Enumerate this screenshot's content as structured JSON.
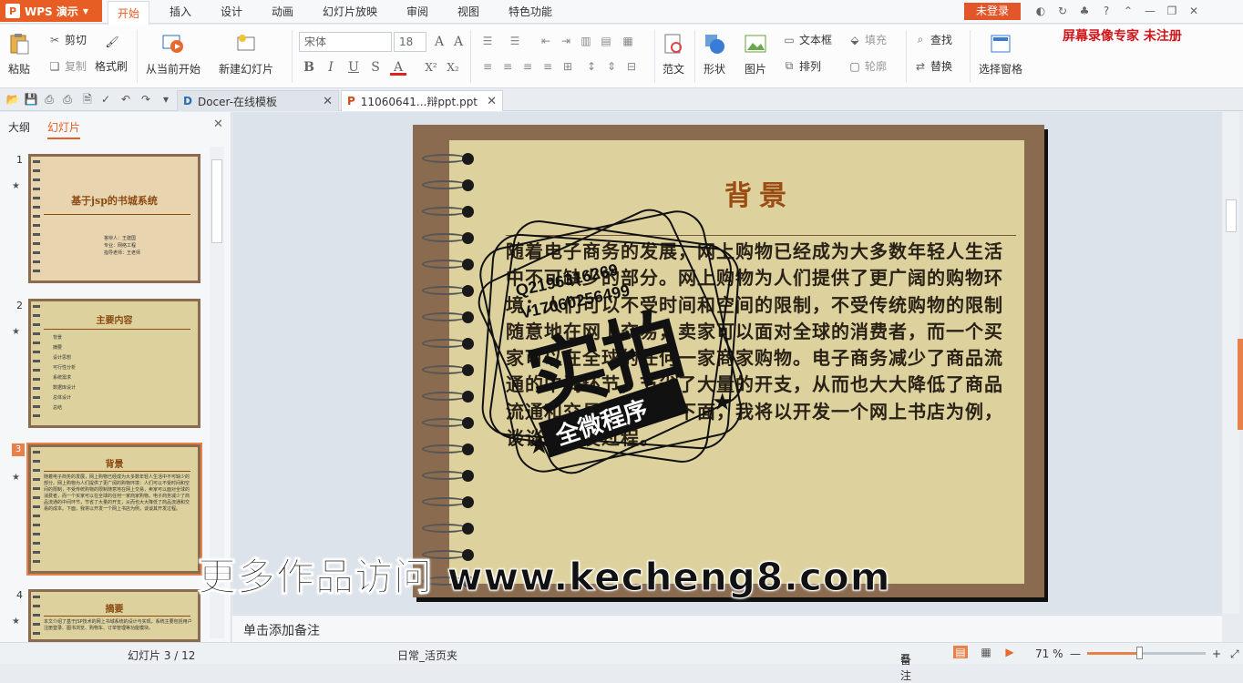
{
  "app": {
    "name": "WPS 演示"
  },
  "menu": [
    "开始",
    "插入",
    "设计",
    "动画",
    "幻灯片放映",
    "审阅",
    "视图",
    "特色功能"
  ],
  "login_label": "未登录",
  "recorder_note": "屏幕录像专家  未注册",
  "ribbon": {
    "paste": "粘贴",
    "cut": "剪切",
    "copy": "复制",
    "format_painter": "格式刷",
    "from_current": "从当前开始",
    "new_slide": "新建幻灯片",
    "font_name": "宋体",
    "font_size": "18",
    "template": "范文",
    "shape": "形状",
    "picture": "图片",
    "textbox": "文本框",
    "arrange": "排列",
    "fill": "填充",
    "outline": "轮廓",
    "find": "查找",
    "replace": "替换",
    "select_pane": "选择窗格"
  },
  "tabs": [
    {
      "label": "Docer-在线模板"
    },
    {
      "label": "11060641...辩ppt.ppt"
    }
  ],
  "panel": {
    "outline_tab": "大纲",
    "slides_tab": "幻灯片"
  },
  "thumbs": [
    {
      "no": "1",
      "title": "基于jsp的书城系统",
      "lines": [
        "答辩人：王建国",
        "专业：网络工程",
        "指导老师：王老师"
      ]
    },
    {
      "no": "2",
      "title": "主要内容",
      "lines": [
        "背景",
        "摘要",
        "设计思想",
        "可行性分析",
        "系统需求",
        "数据库设计",
        "总体设计",
        "总结"
      ]
    },
    {
      "no": "3",
      "title": "背景",
      "text": "随着电子商务的发展，网上购物已经成为大多数年轻人生活中不可缺少的部分。网上购物为人们提供了更广阔的购物环境：人们可以不受时间和空间的限制，不受传统购物的限制随意地在网上交易，卖家可以面对全球的消费者，而一个买家可以在全球的任何一家商家购物。电子商务减少了商品流通的中间环节，节省了大量的开支，从而也大大降低了商品流通和交易的成本。下面，我将以开发一个网上书店为例，谈谈其开发过程。"
    },
    {
      "no": "4",
      "title": "摘要",
      "text": "本文介绍了基于JSP技术的网上书城系统的设计与实现，系统主要包括用户注册登录、图书浏览、购物车、订单管理等功能模块。"
    }
  ],
  "slide": {
    "title": "背景",
    "body": "随着电子商务的发展，网上购物已经成为大多数年轻人生活中不可缺少的部分。网上购物为人们提供了更广阔的购物环境：人们可以不受时间和空间的限制，不受传统购物的限制随意地在网上交易，卖家可以面对全球的消费者，而一个买家可以在全球的任何一家商家购物。电子商务减少了商品流通的中间环节，节省了大量的开支，从而也大大降低了商品流通和交易的成本。下面，我将以开发一个网上书店为例，谈谈其开发过程。"
  },
  "stamp": {
    "line1": "Q2196316269",
    "line2": "V17060256499",
    "big": "实拍",
    "ribbon": "全微程序"
  },
  "watermark": "更多作品访问 www.kecheng8.com",
  "notes_placeholder": "单击添加备注",
  "status": {
    "slide_info": "幻灯片 3 / 12",
    "theme": "日常_活页夹",
    "notes": "备注",
    "zoom": "71 %",
    "zoom_level": 0.71
  }
}
